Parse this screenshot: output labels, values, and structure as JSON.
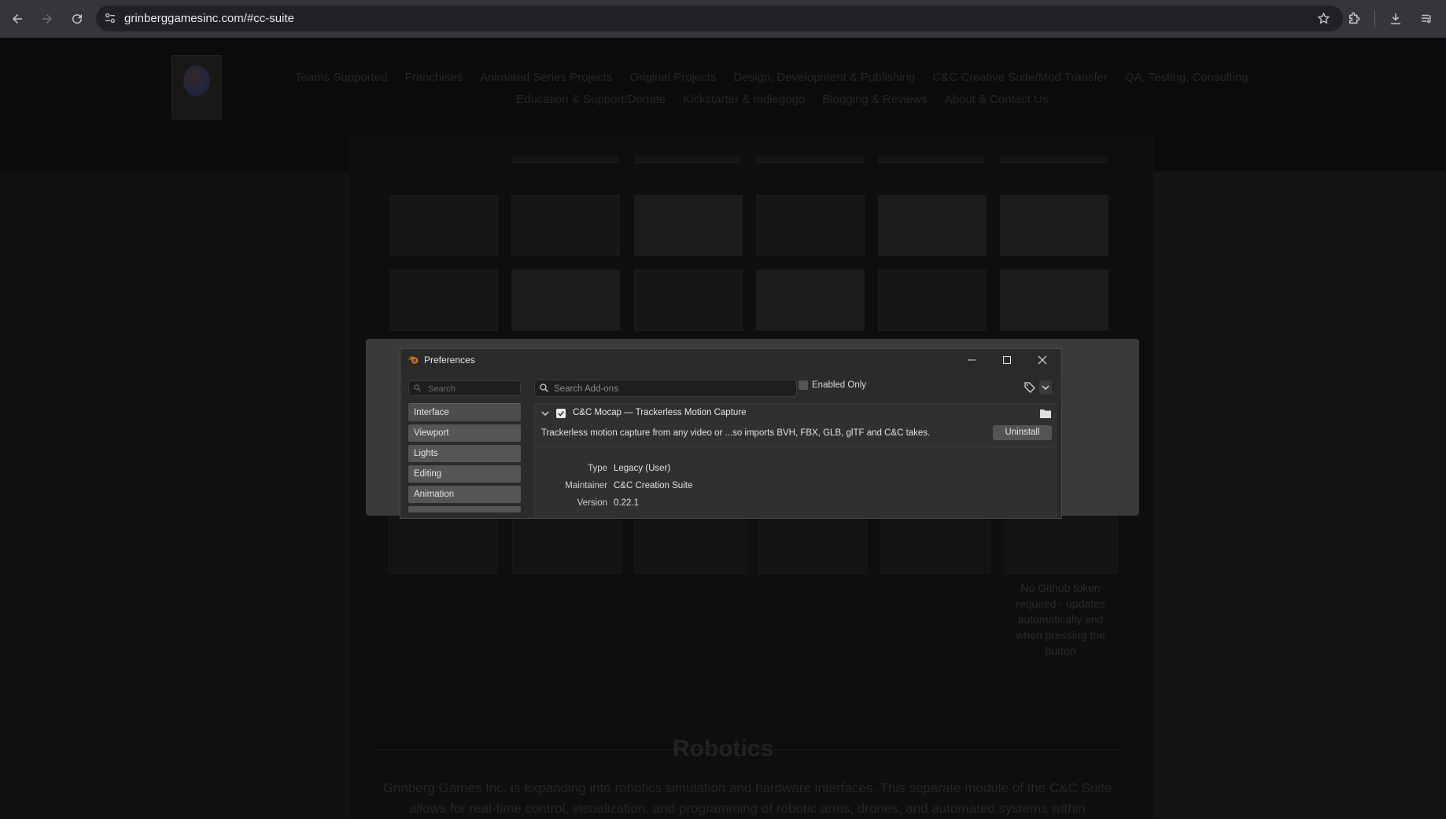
{
  "browser": {
    "url": "grinberggamesinc.com/#cc-suite"
  },
  "site": {
    "nav_row1": [
      "Teams Supported",
      "Franchises",
      "Animated Series Projects",
      "Original Projects",
      "Design, Development & Publishing",
      "C&C Creative Suite/Mod Transfer",
      "QA, Testing, Consulting"
    ],
    "nav_row2": [
      "Education & Support/Donate",
      "Kickstarter & Indiegogo",
      "Blogging & Reviews",
      "About & Contact Us"
    ],
    "github_note": "No Github token required - updates automatically and when pressing the button",
    "robotics_title": "Robotics",
    "robotics_text": "Grinberg Games Inc. is expanding into robotics simulation and hardware interfaces. This separate module of the C&C Suite allows for real-time control, visualization, and programming of robotic arms, drones, and automated systems within"
  },
  "prefs": {
    "title": "Preferences",
    "left_search_placeholder": "Search",
    "categories": [
      "Interface",
      "Viewport",
      "Lights",
      "Editing",
      "Animation"
    ],
    "addon_search_placeholder": "Search Add-ons",
    "enabled_only_label": "Enabled Only",
    "addon": {
      "name": "C&C Mocap — Trackerless Motion Capture",
      "description": "Trackerless motion capture from any video or ...so imports BVH, FBX, GLB, glTF and C&C takes.",
      "uninstall_label": "Uninstall",
      "type_label": "Type",
      "type_value": "Legacy (User)",
      "maintainer_label": "Maintainer",
      "maintainer_value": "C&C Creation Suite",
      "version_label": "Version",
      "version_value": "0.22.1"
    }
  }
}
